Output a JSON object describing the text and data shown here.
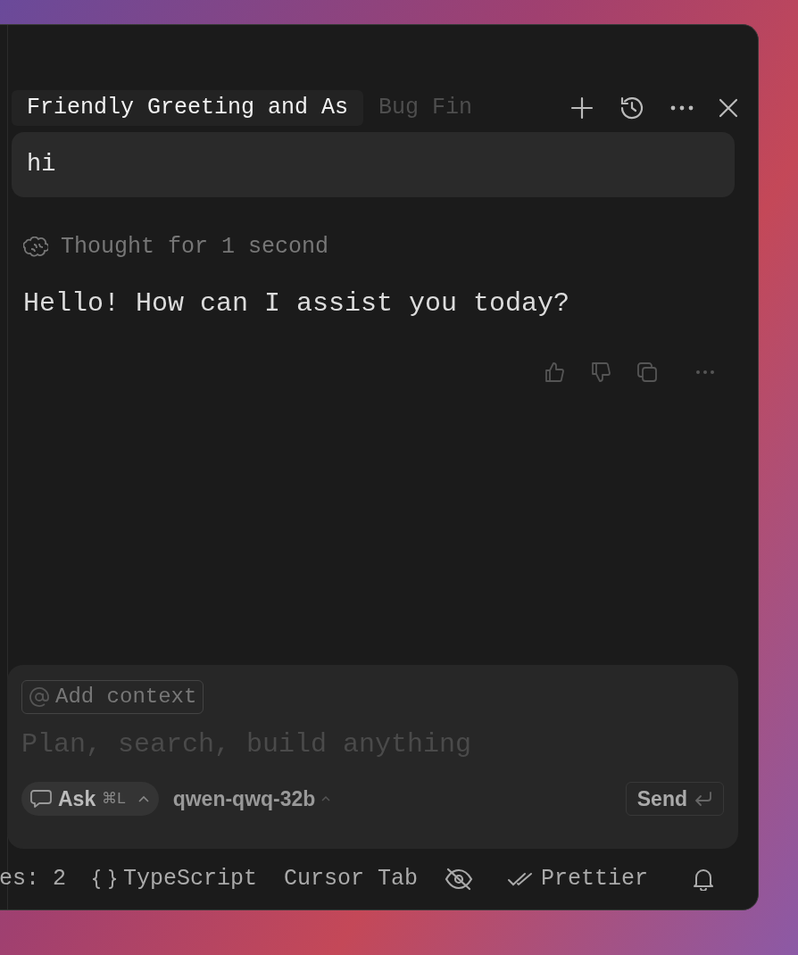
{
  "tabs": [
    {
      "label": "Friendly Greeting and As",
      "selected": true
    },
    {
      "label": "Bug Fin",
      "selected": false
    }
  ],
  "user_message": "hi",
  "response": {
    "thought": "Thought for 1 second",
    "text": "Hello! How can I assist you today?"
  },
  "composer": {
    "context_chip": "Add context",
    "placeholder": "Plan, search, build anything",
    "mode": {
      "label": "Ask",
      "shortcut": "⌘L"
    },
    "model": "qwen-qwq-32b",
    "send": "Send"
  },
  "status_bar": [
    {
      "kind": "plain",
      "text": "es: 2"
    },
    {
      "kind": "braces",
      "text": "TypeScript"
    },
    {
      "kind": "plain",
      "text": "Cursor Tab"
    },
    {
      "kind": "eye-off"
    },
    {
      "kind": "check",
      "text": "Prettier"
    },
    {
      "kind": "bell"
    }
  ]
}
